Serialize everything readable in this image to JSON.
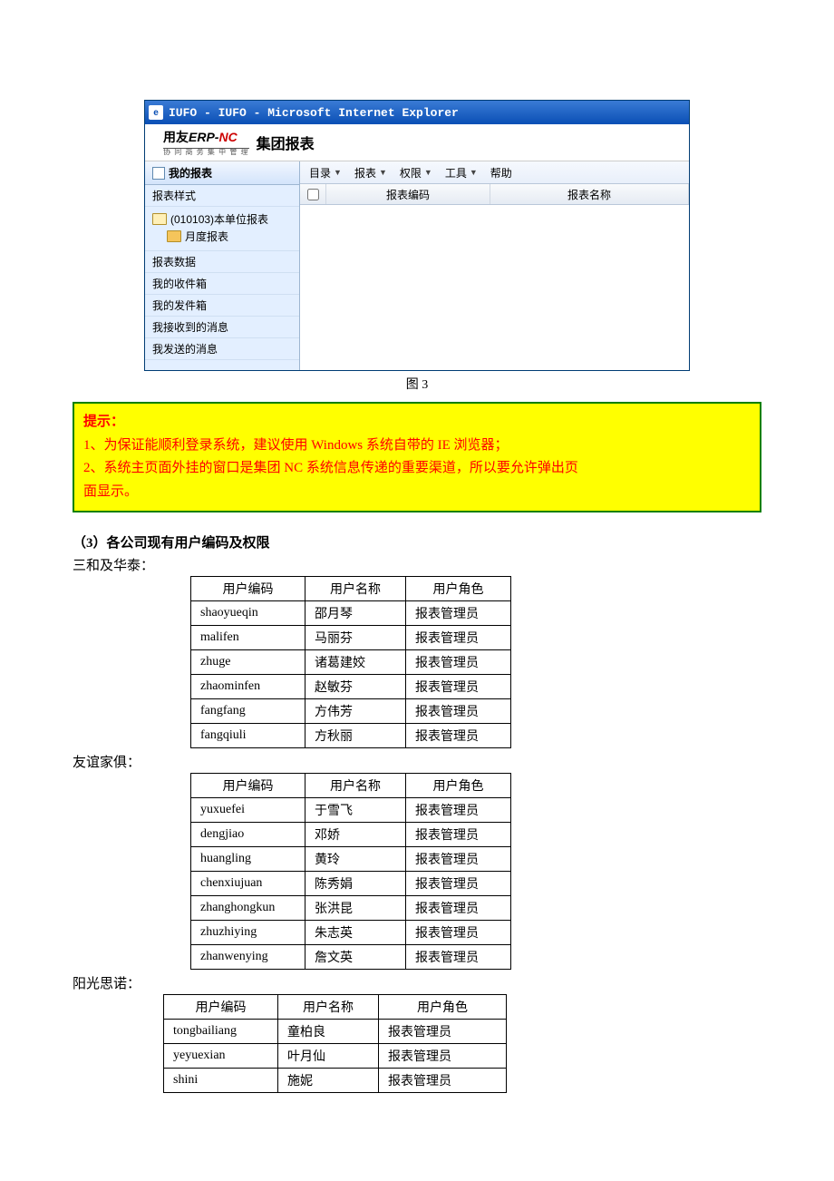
{
  "screenshot": {
    "title": "IUFO - IUFO - Microsoft Internet Explorer",
    "brand_prefix": "用友",
    "brand_erp": "ERP-",
    "brand_nc": "NC",
    "brand_sub": "协 同 商 务     集 中 管 理",
    "brand_title": "集团报表",
    "sidebar": {
      "panel_title": "我的报表",
      "section_sample": "报表样式",
      "tree_item1": "(010103)本单位报表",
      "tree_item2": "月度报表",
      "nav1": "报表数据",
      "nav2": "我的收件箱",
      "nav3": "我的发件箱",
      "nav4": "我接收到的消息",
      "nav5": "我发送的消息"
    },
    "menu": {
      "m1": "目录",
      "m2": "报表",
      "m3": "权限",
      "m4": "工具",
      "m5": "帮助"
    },
    "list_header": {
      "code": "报表编码",
      "name": "报表名称"
    }
  },
  "figure_caption": "图 3",
  "tip": {
    "title": "提示：",
    "line1": "1、为保证能顺利登录系统，建议使用 Windows 系统自带的 IE 浏览器；",
    "line2": "2、系统主页面外挂的窗口是集团 NC 系统信息传递的重要渠道，所以要允许弹出页",
    "line3": "面显示。"
  },
  "section_heading": "（3）各公司现有用户编码及权限",
  "companies": [
    {
      "label": "三和及华泰：",
      "header": {
        "c1": "用户编码",
        "c2": "用户名称",
        "c3": "用户角色"
      },
      "rows": {
        "r0": {
          "code": "shaoyueqin",
          "name": "邵月琴",
          "role": "报表管理员"
        },
        "r1": {
          "code": "malifen",
          "name": "马丽芬",
          "role": "报表管理员"
        },
        "r2": {
          "code": "zhuge",
          "name": "诸葛建姣",
          "role": "报表管理员"
        },
        "r3": {
          "code": "zhaominfen",
          "name": "赵敏芬",
          "role": "报表管理员"
        },
        "r4": {
          "code": "fangfang",
          "name": "方伟芳",
          "role": "报表管理员"
        },
        "r5": {
          "code": "fangqiuli",
          "name": "方秋丽",
          "role": "报表管理员"
        }
      }
    },
    {
      "label": "友谊家俱：",
      "header": {
        "c1": "用户编码",
        "c2": "用户名称",
        "c3": "用户角色"
      },
      "rows": {
        "r0": {
          "code": "yuxuefei",
          "name": "于雪飞",
          "role": "报表管理员"
        },
        "r1": {
          "code": "dengjiao",
          "name": "邓娇",
          "role": "报表管理员"
        },
        "r2": {
          "code": "huangling",
          "name": "黄玲",
          "role": "报表管理员"
        },
        "r3": {
          "code": "chenxiujuan",
          "name": "陈秀娟",
          "role": "报表管理员"
        },
        "r4": {
          "code": "zhanghongkun",
          "name": "张洪昆",
          "role": "报表管理员"
        },
        "r5": {
          "code": "zhuzhiying",
          "name": "朱志英",
          "role": "报表管理员"
        },
        "r6": {
          "code": "zhanwenying",
          "name": "詹文英",
          "role": "报表管理员"
        }
      }
    },
    {
      "label": "阳光思诺：",
      "header": {
        "c1": "用户编码",
        "c2": "用户名称",
        "c3": "用户角色"
      },
      "rows": {
        "r0": {
          "code": "tongbailiang",
          "name": "童柏良",
          "role": "报表管理员"
        },
        "r1": {
          "code": "yeyuexian",
          "name": "叶月仙",
          "role": "报表管理员"
        },
        "r2": {
          "code": "shini",
          "name": "施妮",
          "role": "报表管理员"
        }
      }
    }
  ]
}
